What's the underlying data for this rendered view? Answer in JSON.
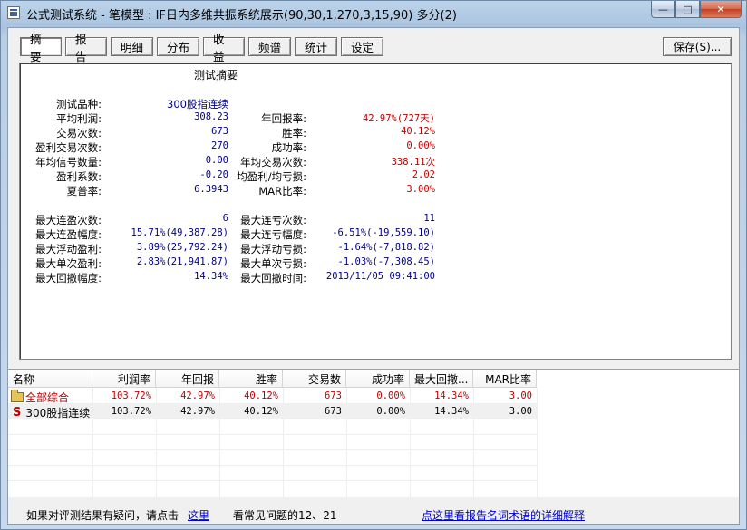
{
  "window": {
    "title": "公式测试系统 - 笔模型 : IF日内多维共振系统展示(90,30,1,270,3,15,90) 多分(2)",
    "minimize": "—",
    "maximize": "□",
    "close": "✕"
  },
  "tabs": [
    "摘要",
    "报告",
    "明细",
    "分布",
    "收益",
    "频谱",
    "统计",
    "设定"
  ],
  "save_label": "保存(S)...",
  "summary": {
    "title": "测试摘要",
    "left": [
      {
        "label": "测试品种:",
        "value": "300股指连续"
      },
      {
        "label": "平均利润:",
        "value": "308.23"
      },
      {
        "label": "交易次数:",
        "value": "673"
      },
      {
        "label": "盈利交易次数:",
        "value": "270"
      },
      {
        "label": "年均信号数量:",
        "value": "0.00"
      },
      {
        "label": "盈利系数:",
        "value": "-0.20"
      },
      {
        "label": "夏普率:",
        "value": "6.3943"
      }
    ],
    "right": [
      {
        "label": "",
        "value": ""
      },
      {
        "label": "年回报率:",
        "value": "42.97%(727天)"
      },
      {
        "label": "胜率:",
        "value": "40.12%"
      },
      {
        "label": "成功率:",
        "value": "0.00%"
      },
      {
        "label": "年均交易次数:",
        "value": "338.11次"
      },
      {
        "label": "均盈利/均亏损:",
        "value": "2.02"
      },
      {
        "label": "MAR比率:",
        "value": "3.00%"
      }
    ],
    "left2": [
      {
        "label": "最大连盈次数:",
        "value": "6"
      },
      {
        "label": "最大连盈幅度:",
        "value": "15.71%(49,387.28)"
      },
      {
        "label": "最大浮动盈利:",
        "value": "3.89%(25,792.24)"
      },
      {
        "label": "最大单次盈利:",
        "value": "2.83%(21,941.87)"
      },
      {
        "label": "最大回撤幅度:",
        "value": "14.34%"
      }
    ],
    "right2": [
      {
        "label": "最大连亏次数:",
        "value": "11"
      },
      {
        "label": "最大连亏幅度:",
        "value": "-6.51%(-19,559.10)"
      },
      {
        "label": "最大浮动亏损:",
        "value": "-1.64%(-7,818.82)"
      },
      {
        "label": "最大单次亏损:",
        "value": "-1.03%(-7,308.45)"
      },
      {
        "label": "最大回撤时间:",
        "value": "2013/11/05 09:41:00"
      }
    ]
  },
  "table": {
    "headers": [
      "名称",
      "利润率",
      "年回报",
      "胜率",
      "交易数",
      "成功率",
      "最大回撤...",
      "MAR比率"
    ],
    "rows": [
      {
        "icon": "folder-icon",
        "name": "全部综合",
        "values": [
          "103.72%",
          "42.97%",
          "40.12%",
          "673",
          "0.00%",
          "14.34%",
          "3.00"
        ],
        "color": "#c00000"
      },
      {
        "icon": "strategy-s-icon",
        "name": "300股指连续",
        "values": [
          "103.72%",
          "42.97%",
          "40.12%",
          "673",
          "0.00%",
          "14.34%",
          "3.00"
        ],
        "color": "#000000"
      }
    ]
  },
  "footer": {
    "prefix": "如果对评测结果有疑问，请点击",
    "link": "这里",
    "suffix": "看常见问题的12、21",
    "help_link": "点这里看报告名词术语的详细解释"
  }
}
